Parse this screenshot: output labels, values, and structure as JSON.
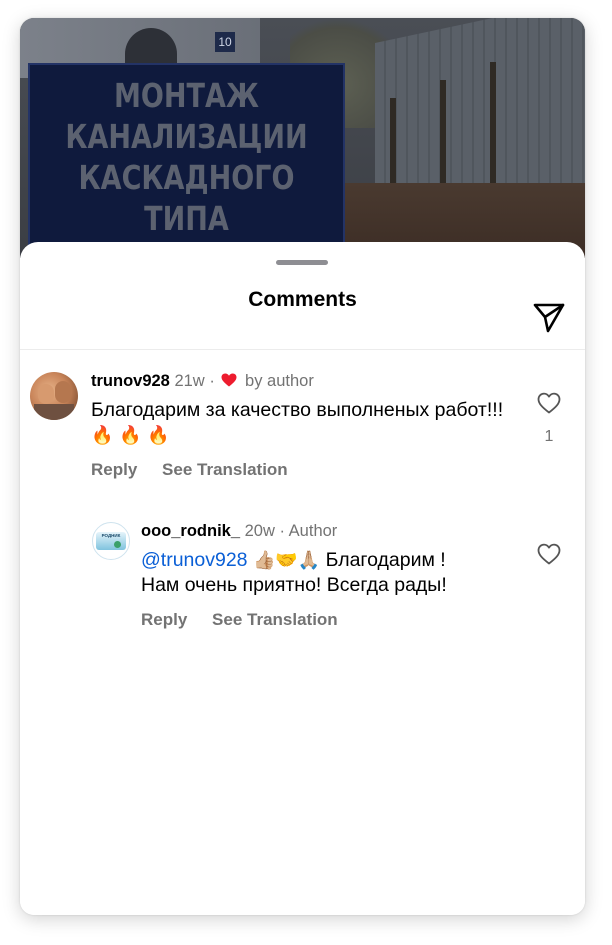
{
  "video_preview": {
    "house_number": "10",
    "title_lines": [
      "МОНТАЖ",
      "КАНАЛИЗАЦИИ",
      "КАСКАДНОГО",
      "ТИПА"
    ]
  },
  "sheet": {
    "title": "Comments"
  },
  "comments": [
    {
      "username": "trunov928",
      "time": "21w",
      "separator": "·",
      "liked_by_author_label": "by author",
      "text": "Благодарим за качество выполненых работ!!!",
      "emojis": "🔥 🔥 🔥",
      "reply_label": "Reply",
      "translate_label": "See Translation",
      "like_count": "1",
      "avatar": "profile-photo"
    },
    {
      "username": "ooo_rodnik_",
      "time": "20w",
      "separator": "·",
      "author_label": "Author",
      "mention": "@trunov928",
      "emojis": "👍🏼🤝🙏🏼",
      "text_part1": "Благодарим !",
      "text_part2": "Нам очень приятно! Всегда рады!",
      "reply_label": "Reply",
      "translate_label": "See Translation",
      "avatar": "rodnik-logo",
      "avatar_text": "РОДНИК"
    }
  ],
  "colors": {
    "heart_red": "#ed1c2e",
    "mention_blue": "#0a5fd6",
    "muted_gray": "#737373"
  }
}
